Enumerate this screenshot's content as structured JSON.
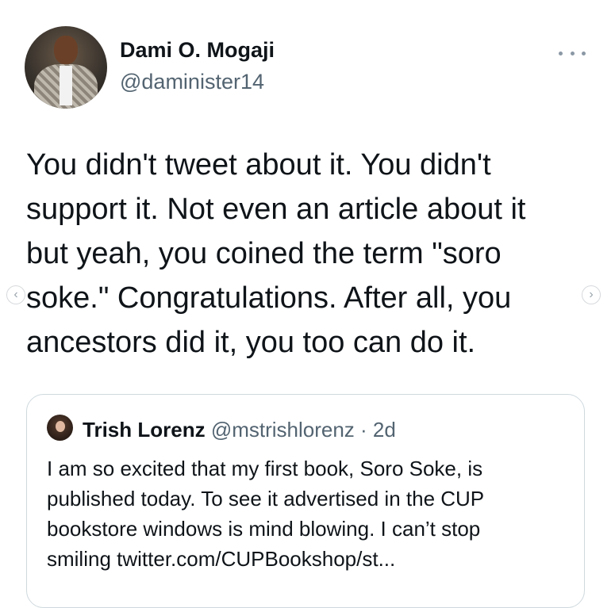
{
  "author": {
    "display_name": "Dami O. Mogaji",
    "handle": "@daminister14"
  },
  "more_icon": "ellipsis-icon",
  "tweet": {
    "text": "You didn't tweet about it. You didn't\nsupport it. Not even an article about it\nbut yeah, you coined the term \"soro\nsoke.\" Congratulations. After all, you\nancestors did it, you too can do it."
  },
  "carousel": {
    "prev_label": "‹",
    "next_label": "›"
  },
  "quoted_tweet": {
    "display_name": "Trish Lorenz",
    "handle": "@mstrishlorenz",
    "separator": " · ",
    "time": "2d",
    "text": "I am so excited that my first book, Soro Soke, is\npublished today. To see it advertised in the CUP\nbookstore windows is mind blowing. I can’t stop\nsmiling twitter.com/CUPBookshop/st..."
  }
}
